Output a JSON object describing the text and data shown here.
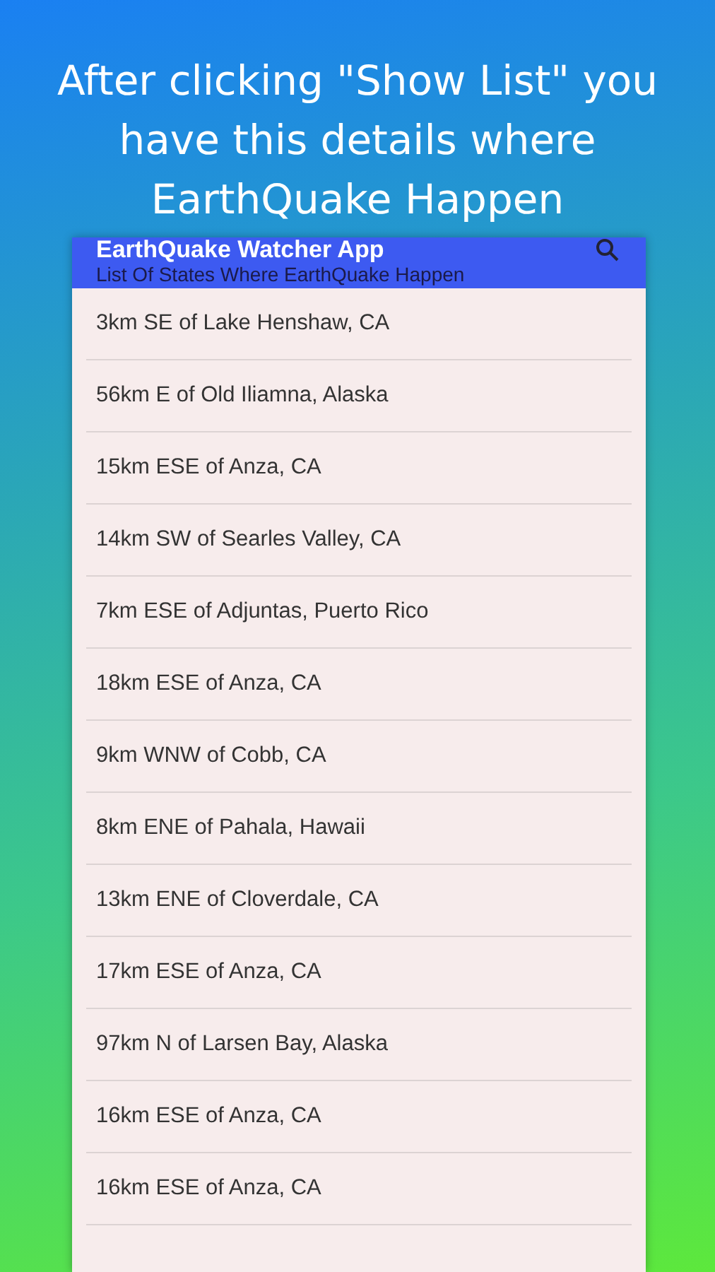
{
  "caption": "After clicking \"Show List\" you have this details where EarthQuake Happen",
  "app_bar": {
    "title": "EarthQuake Watcher App",
    "subtitle": "List Of States Where EarthQuake Happen"
  },
  "places": [
    "3km SE of Lake Henshaw, CA",
    "56km E of Old Iliamna, Alaska",
    "15km ESE of Anza, CA",
    "14km SW of Searles Valley, CA",
    "7km ESE of Adjuntas, Puerto Rico",
    "18km ESE of Anza, CA",
    "9km WNW of Cobb, CA",
    "8km ENE of Pahala, Hawaii",
    "13km ENE of Cloverdale, CA",
    "17km ESE of Anza, CA",
    "97km N of Larsen Bay, Alaska",
    "16km ESE of Anza, CA",
    "16km ESE of Anza, CA"
  ]
}
